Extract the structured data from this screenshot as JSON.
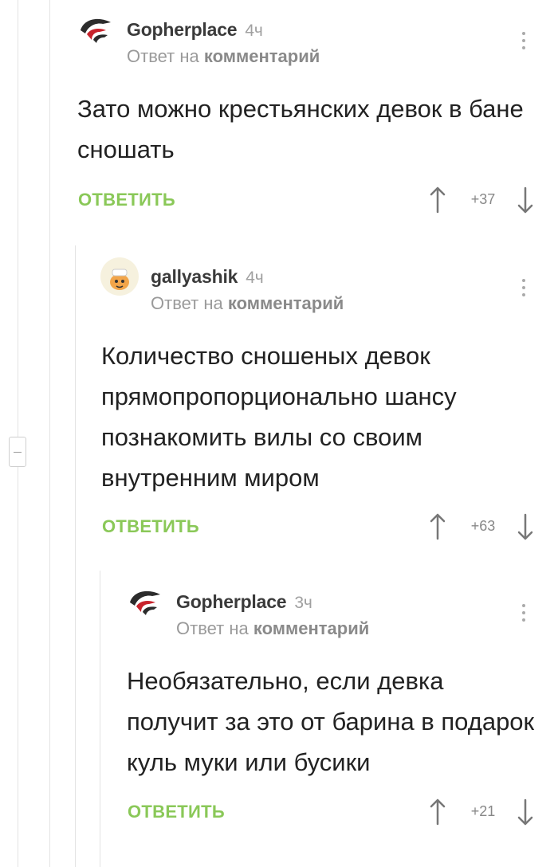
{
  "comments": [
    {
      "author": "Gopherplace",
      "time": "4ч",
      "reply_prefix": "Ответ на",
      "reply_link": "комментарий",
      "text": "Зато можно крестьянских девок в бане сношать",
      "reply_label": "ОТВЕТИТЬ",
      "rating": "+37"
    },
    {
      "author": "gallyashik",
      "time": "4ч",
      "reply_prefix": "Ответ на",
      "reply_link": "комментарий",
      "text": "Количество сношеных девок прямопропорционально шансу познакомить вилы со своим внутренним миром",
      "reply_label": "ОТВЕТИТЬ",
      "rating": "+63"
    },
    {
      "author": "Gopherplace",
      "time": "3ч",
      "reply_prefix": "Ответ на",
      "reply_link": "комментарий",
      "text": "Необязательно,  если девка получит за это от барина в подарок куль муки или бусики",
      "reply_label": "ОТВЕТИТЬ",
      "rating": "+21"
    }
  ],
  "icons": {
    "avatar_gopher": "bird-logo-avatar",
    "avatar_gallyashik": "cartoon-character-avatar",
    "more": "more-vertical-icon",
    "up": "arrow-up-icon",
    "down": "arrow-down-icon",
    "collapse": "minus-icon"
  },
  "colors": {
    "reply_green": "#8ac858",
    "muted": "#9a9a9a",
    "thread_line": "#e3e3e3"
  }
}
